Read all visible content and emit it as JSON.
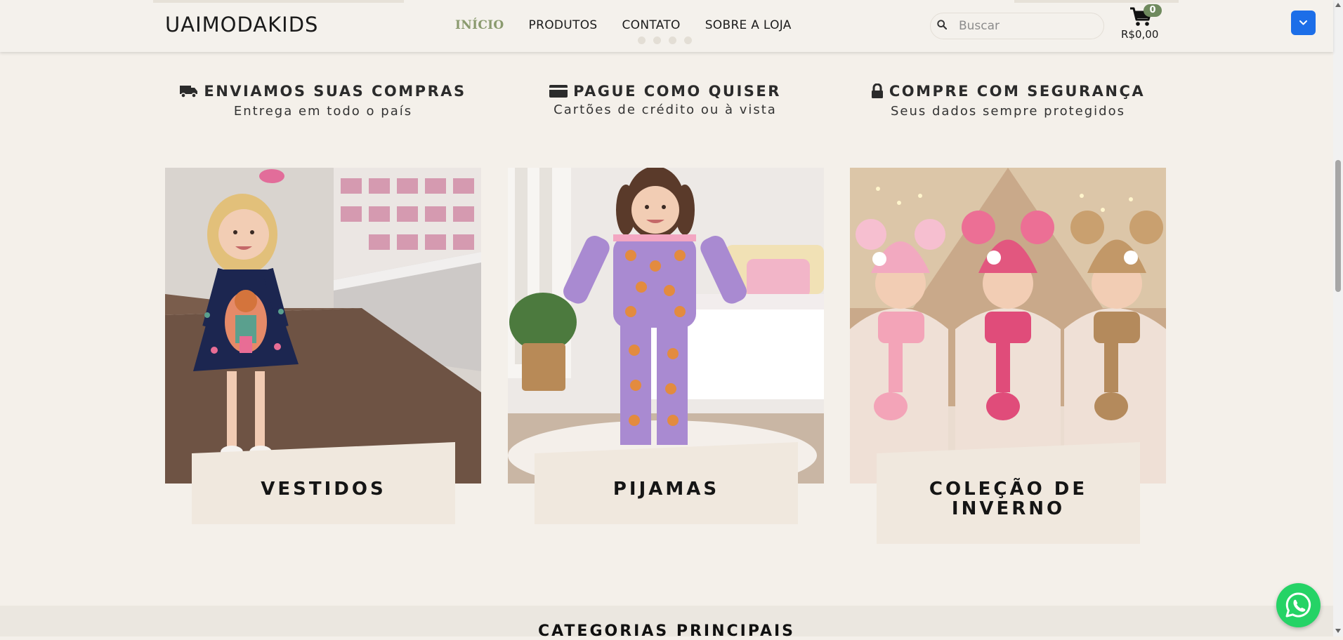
{
  "header": {
    "logo": "UAIMODAKIDS",
    "nav": [
      {
        "label": "INÍCIO",
        "active": true
      },
      {
        "label": "PRODUTOS",
        "active": false
      },
      {
        "label": "CONTATO",
        "active": false
      },
      {
        "label": "SOBRE A LOJA",
        "active": false
      }
    ],
    "search_placeholder": "Buscar",
    "cart_count": "0",
    "cart_total": "R$0,00",
    "accent_color": "#8a9a6e",
    "cart_badge_color": "#6f8a5e"
  },
  "features": [
    {
      "icon": "truck-icon",
      "title": "ENVIAMOS SUAS COMPRAS",
      "subtitle": "Entrega em todo o país"
    },
    {
      "icon": "credit-card-icon",
      "title": "PAGUE COMO QUISER",
      "subtitle": "Cartões de crédito ou à vista"
    },
    {
      "icon": "lock-icon",
      "title": "COMPRE COM SEGURANÇA",
      "subtitle": "Seus dados sempre protegidos"
    }
  ],
  "categories": [
    {
      "label": "VESTIDOS",
      "image": "girl-in-navy-dress-photo"
    },
    {
      "label": "PIJAMAS",
      "image": "girl-in-purple-pajamas-photo"
    },
    {
      "label": "COLEÇÃO DE INVERNO",
      "image": "three-girls-winter-hats-photo"
    }
  ],
  "section_title": "CATEGORIAS PRINCIPAIS",
  "whatsapp_color": "#25d366",
  "dropdown_color": "#1c6ee8"
}
